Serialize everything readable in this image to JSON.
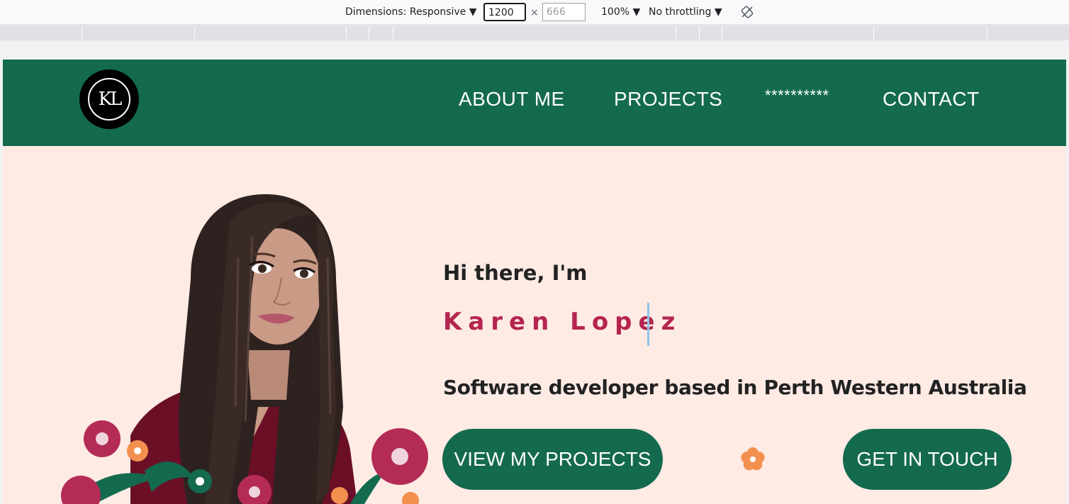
{
  "devtools": {
    "dimensions_label": "Dimensions: Responsive ▼",
    "width_value": "1200",
    "height_placeholder": "666",
    "times": "×",
    "zoom": "100% ▼",
    "throttling": "No throttling ▼"
  },
  "nav": {
    "logo_text": "KL",
    "links": [
      "ABOUT ME",
      "PROJECTS",
      "**********",
      "CONTACT"
    ]
  },
  "hero": {
    "greeting": "Hi there, I'm",
    "name": "Karen Lopez",
    "tagline": "Software developer based in Perth Western Australia",
    "primary_button": "VIEW MY PROJECTS",
    "secondary_button": "GET IN TOUCH"
  },
  "colors": {
    "nav_bg": "#146a4e",
    "page_bg": "#fdebe4",
    "name_color": "#b5254f",
    "button_bg": "#146a4e"
  }
}
